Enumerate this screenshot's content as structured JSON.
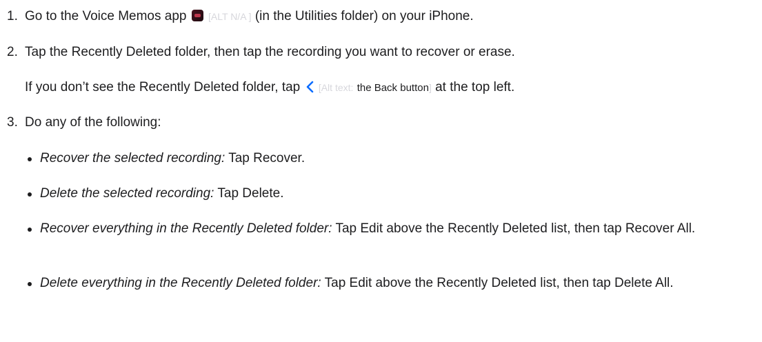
{
  "steps": {
    "s1": {
      "number": "1.",
      "text_before": "Go to the Voice Memos app",
      "alt_text": "[ALT N/A ]",
      "text_after": "(in the Utilities folder) on your iPhone.",
      "icon": "voice-memos-app-icon"
    },
    "s2": {
      "number": "2.",
      "text": "Tap the Recently Deleted folder, then tap the recording you want to recover or erase.",
      "note_before": "If you don’t see the Recently Deleted folder, tap",
      "note_alt_prefix": "[Alt text:",
      "note_alt_label": "the Back button",
      "note_alt_suffix": "]",
      "note_after": "at the top left.",
      "icon": "back-chevron-icon"
    },
    "s3": {
      "number": "3.",
      "text": "Do any of the following:",
      "bullets": [
        {
          "italic": "Recover the selected recording:",
          "text": "Tap Recover."
        },
        {
          "italic": "Delete the selected recording:",
          "text": "Tap Delete."
        },
        {
          "italic": "Recover everything in the Recently Deleted folder:",
          "text": "Tap Edit above the Recently Deleted list, then tap Recover All."
        },
        {
          "italic": "Delete everything in the Recently Deleted folder:",
          "text": "Tap Edit above the Recently Deleted list, then tap Delete All."
        }
      ]
    }
  },
  "colors": {
    "text": "#1d1d1f",
    "alt_text": "#d7d7dc",
    "accent_chevron": "#0a6cff"
  }
}
